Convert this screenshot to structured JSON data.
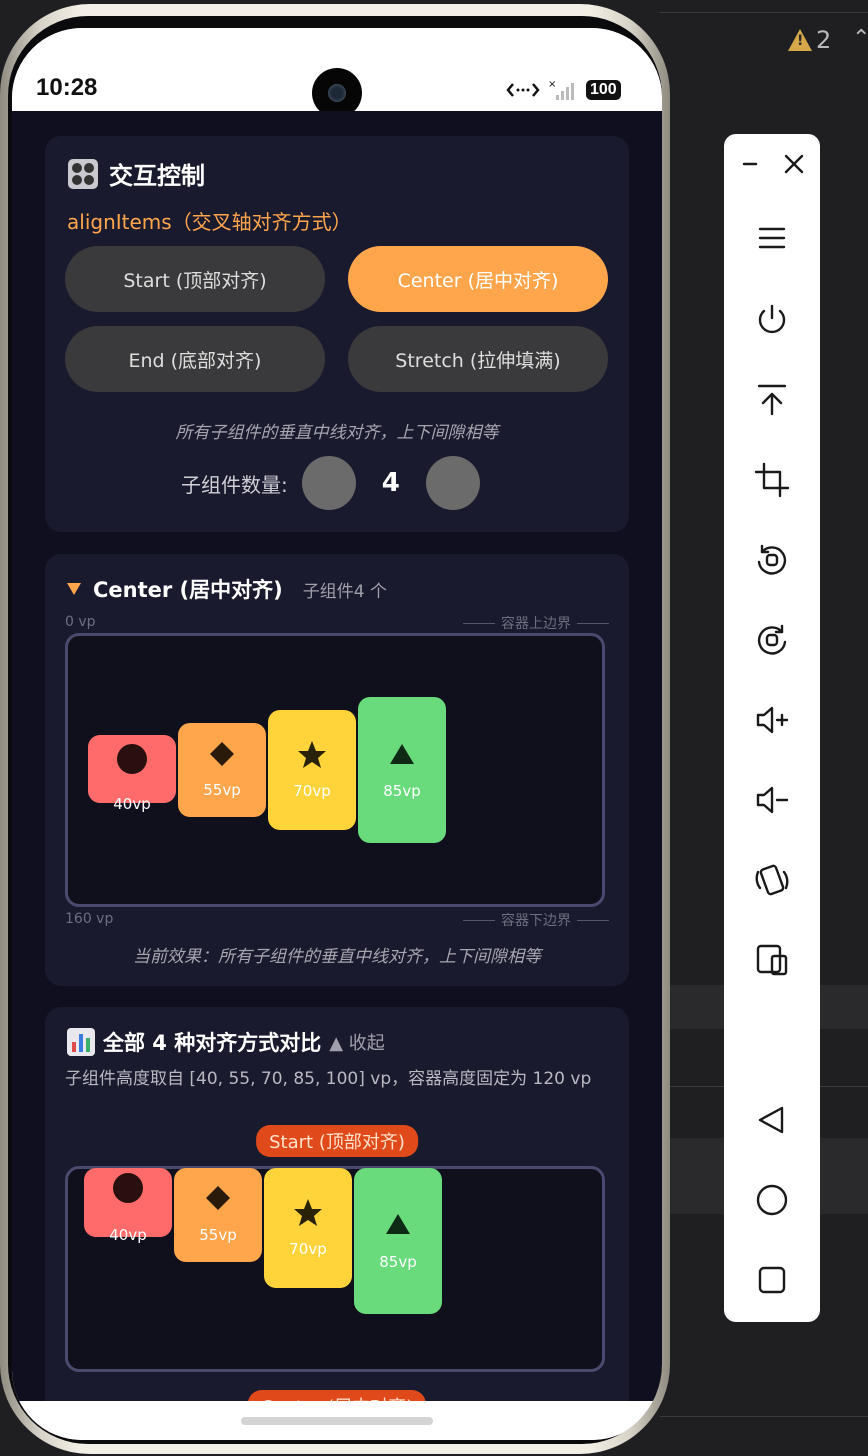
{
  "status_bar": {
    "time": "10:28",
    "battery": "100"
  },
  "controls": {
    "icon": "control-panel-icon",
    "title": "交互控制",
    "subtitle": "alignItems（交叉轴对齐方式）",
    "options": [
      {
        "label": "Start (顶部对齐)",
        "selected": false
      },
      {
        "label": "Center (居中对齐)",
        "selected": true
      },
      {
        "label": "End (底部对齐)",
        "selected": false
      },
      {
        "label": "Stretch (拉伸填满)",
        "selected": false
      }
    ],
    "description": "所有子组件的垂直中线对齐，上下间隙相等",
    "count_label": "子组件数量:",
    "count_value": "4"
  },
  "preview": {
    "title": "Center (居中对齐)",
    "count_text": "子组件4 个",
    "scale_top": "0 vp",
    "scale_bottom": "160 vp",
    "edge_top": "容器上边界",
    "edge_bottom": "容器下边界",
    "effect": "当前效果：所有子组件的垂直中线对齐，上下间隙相等",
    "tiles": [
      {
        "label": "40vp",
        "color": "#ff6b6b",
        "icon": "circle-icon"
      },
      {
        "label": "55vp",
        "color": "#ffa64d",
        "icon": "diamond-icon"
      },
      {
        "label": "70vp",
        "color": "#ffd43b",
        "icon": "star-icon"
      },
      {
        "label": "85vp",
        "color": "#69db7c",
        "icon": "triangle-icon"
      }
    ]
  },
  "comparison": {
    "icon": "bar-chart-icon",
    "title": "全部 4 种对齐方式对比",
    "collapse_label": "▲ 收起",
    "desc": "子组件高度取自 [40, 55, 70, 85, 100] vp，容器高度固定为 120 vp",
    "sections": [
      {
        "badge": "Start (顶部对齐)"
      },
      {
        "badge": "Center (居中对齐)"
      }
    ]
  },
  "colors": {
    "accent": "#ffa64d",
    "badge": "#e04a1a"
  }
}
